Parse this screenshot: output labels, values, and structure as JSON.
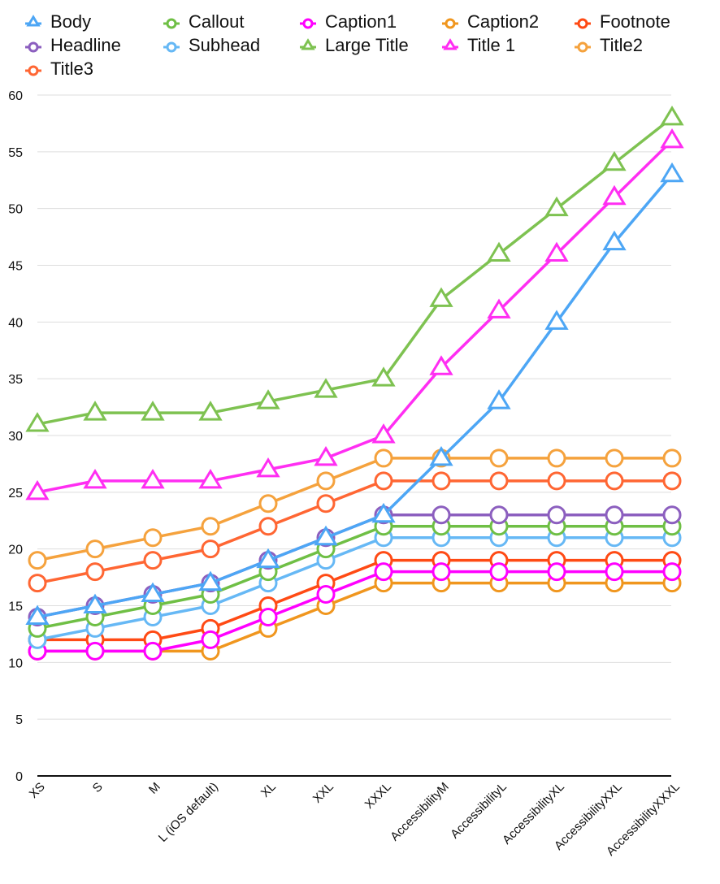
{
  "chart_data": {
    "type": "line",
    "title": "",
    "xlabel": "",
    "ylabel": "",
    "ylim": [
      0,
      60
    ],
    "yticks": [
      0,
      5,
      10,
      15,
      20,
      25,
      30,
      35,
      40,
      45,
      50,
      55,
      60
    ],
    "grid": true,
    "legend_position": "top",
    "categories": [
      "XS",
      "S",
      "M",
      "L (iOS default)",
      "XL",
      "XXL",
      "XXXL",
      "AccessibilityM",
      "AccessibilityL",
      "AccessibilityXL",
      "AccessibilityXXL",
      "AccessibilityXXXL"
    ],
    "series": [
      {
        "name": "Body",
        "color": "#4da6f5",
        "marker": "triangle",
        "values": [
          14,
          15,
          16,
          17,
          19,
          21,
          23,
          28,
          33,
          40,
          47,
          53
        ]
      },
      {
        "name": "Callout",
        "color": "#6fbf45",
        "marker": "circle",
        "values": [
          13,
          14,
          15,
          16,
          18,
          20,
          22,
          22,
          22,
          22,
          22,
          22
        ]
      },
      {
        "name": "Caption1",
        "color": "#ff00ff",
        "marker": "circle",
        "values": [
          11,
          11,
          11,
          12,
          14,
          16,
          18,
          18,
          18,
          18,
          18,
          18
        ]
      },
      {
        "name": "Caption2",
        "color": "#f0961e",
        "marker": "circle",
        "values": [
          11,
          11,
          11,
          11,
          13,
          15,
          17,
          17,
          17,
          17,
          17,
          17
        ]
      },
      {
        "name": "Footnote",
        "color": "#ff4a14",
        "marker": "circle",
        "values": [
          12,
          12,
          12,
          13,
          15,
          17,
          19,
          19,
          19,
          19,
          19,
          19
        ]
      },
      {
        "name": "Headline",
        "color": "#8c5fbf",
        "marker": "circle",
        "values": [
          14,
          15,
          16,
          17,
          19,
          21,
          23,
          23,
          23,
          23,
          23,
          23
        ]
      },
      {
        "name": "Subhead",
        "color": "#66b8f5",
        "marker": "circle",
        "values": [
          12,
          13,
          14,
          15,
          17,
          19,
          21,
          21,
          21,
          21,
          21,
          21
        ]
      },
      {
        "name": "Large Title",
        "color": "#7ec251",
        "marker": "triangle",
        "values": [
          31,
          32,
          32,
          32,
          33,
          34,
          35,
          42,
          46,
          50,
          54,
          58
        ]
      },
      {
        "name": "Title 1",
        "color": "#ff2ef2",
        "marker": "triangle",
        "values": [
          25,
          26,
          26,
          26,
          27,
          28,
          30,
          36,
          41,
          46,
          51,
          56
        ]
      },
      {
        "name": "Title2",
        "color": "#f5a23d",
        "marker": "circle",
        "values": [
          19,
          20,
          21,
          22,
          24,
          26,
          28,
          28,
          28,
          28,
          28,
          28
        ]
      },
      {
        "name": "Title3",
        "color": "#ff6633",
        "marker": "circle",
        "values": [
          17,
          18,
          19,
          20,
          22,
          24,
          26,
          26,
          26,
          26,
          26,
          26
        ]
      }
    ],
    "legend_labels": [
      {
        "label": "Body"
      },
      {
        "label": "Callout"
      },
      {
        "label": "Caption1"
      },
      {
        "label": "Caption2"
      },
      {
        "label": "Footnote"
      },
      {
        "label": "Headline"
      },
      {
        "label": "Subhead"
      },
      {
        "label": "Large Title"
      },
      {
        "label": "Title 1"
      },
      {
        "label": "Title2"
      },
      {
        "label": "Title3"
      }
    ]
  }
}
